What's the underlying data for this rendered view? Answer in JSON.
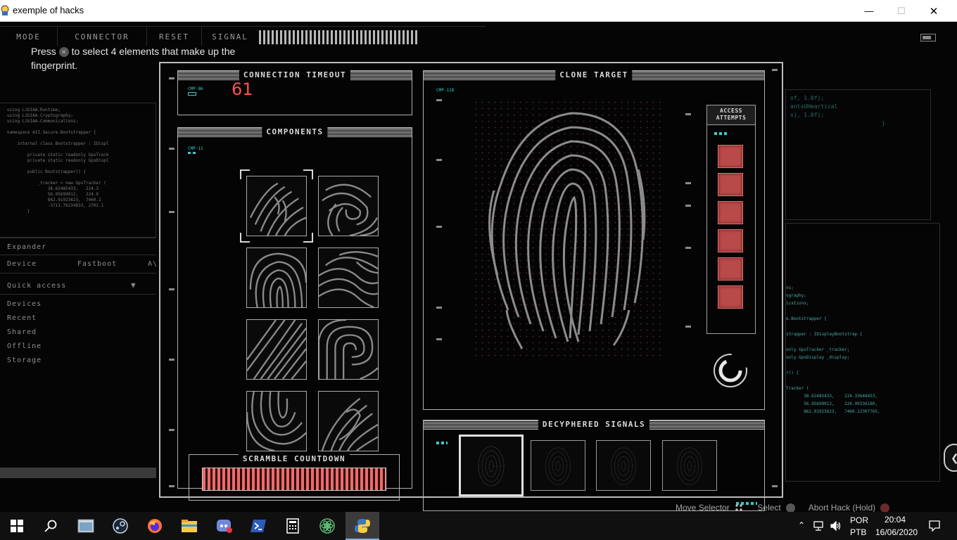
{
  "window": {
    "title": "exemple of hacks",
    "minimize_glyph": "—",
    "maximize_glyph": "☐",
    "close_glyph": "✕"
  },
  "nav": {
    "tabs": [
      "MODE",
      "CONNECTOR",
      "RESET",
      "SIGNAL"
    ]
  },
  "hint": {
    "prefix": "Press",
    "button_glyph": "✕",
    "suffix": "to select 4 elements that make up the fingerprint."
  },
  "sidebar": {
    "code": "using LibIAA.Runtime;\nusing LibIAA.Cryptography;\nusing LibIAA.Communications;\n\nnamespace AII.Secure.Bootstrapper {\n\n    internal class Bootstrapper : IDispl\n\n        private static readonly GpsTrack\n        private static readonly GpsDispl\n\n        public Bootstrapper() {\n\n            _tracker = new GpsTracker (\n                38.62485433,   224.3\n                56.95699012,   224.9\n                862.91923623,  7460.2\n                -3713.76234833, 2702.1\n        }",
    "expander": "Expander",
    "device": "Device",
    "fastboot": "Fastboot",
    "fastboot_suffix": "A\\",
    "quick_access": "Quick access",
    "quick_access_chevron": "▼",
    "items": [
      "Devices",
      "Recent",
      "Shared",
      "Offline",
      "Storage"
    ]
  },
  "right_code": {
    "top": "of, 1.0f);\nantsUHeartical\nx), 1.0f);\n                           }",
    "bottom": "ns;\nography;\nications;\n\ne.Bootstrapper {\n\nstrapper : IDisplayBootstrap {\n\nonly GpsTracker _tracker;\nonly GpsDisplay _display;\n\nr() {\n\nTracker (\n       38.62485433,    224.33648453,\n       56.95699012,    224.99336180,\n       862.91923623,   7460.12307765,"
  },
  "hack": {
    "timeout": {
      "title": "CONNECTION TIMEOUT",
      "tag": "CMP-86",
      "value": "61"
    },
    "components": {
      "title": "COMPONENTS",
      "tag": "CMP-11",
      "count": 8,
      "selected_index": 0
    },
    "scramble": {
      "title": "SCRAMBLE COUNTDOWN",
      "progress": 1.0
    },
    "clone": {
      "title": "CLONE TARGET",
      "tag": "CMP-118",
      "access_title_1": "ACCESS",
      "access_title_2": "ATTEMPTS",
      "attempts_remaining": 6
    },
    "signals": {
      "title": "DECYPHERED SIGNALS",
      "count": 4,
      "selected_index": 0
    }
  },
  "controls": {
    "move": "Move Selector",
    "select": "Select",
    "abort": "Abort Hack (Hold)"
  },
  "taskbar": {
    "apps": [
      "start-icon",
      "search-icon",
      "explorer-window-icon",
      "steam-icon",
      "firefox-icon",
      "file-explorer-icon",
      "discord-icon",
      "powershell-icon",
      "calculator-icon",
      "atom-icon",
      "python-icon"
    ],
    "lang_top": "POR",
    "lang_bottom": "PTB",
    "time": "20:04",
    "date": "16/06/2020"
  },
  "colors": {
    "timeout": "#ff4f4f",
    "attempt": "#b84a4a",
    "scramble": "#f06a6a",
    "tag": "#3fc9c9"
  }
}
